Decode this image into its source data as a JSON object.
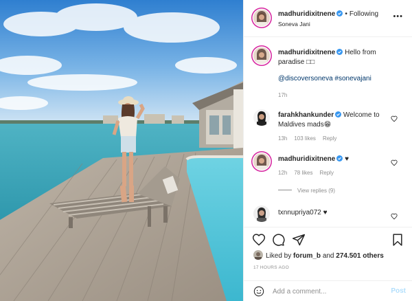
{
  "post": {
    "username": "madhuridixitnene",
    "follow_status": "Following",
    "location": "Soneva Jani",
    "caption": "Hello from paradise",
    "caption_tags": "@discoversoneva #sonevajani",
    "caption_time": "17h"
  },
  "comments": [
    {
      "username": "farahkhankunder",
      "text": "Welcome to Maldives mads😁",
      "time": "13h",
      "likes": "103 likes",
      "reply": "Reply"
    },
    {
      "username": "madhuridixitnene",
      "text": "♥",
      "time": "12h",
      "likes": "78 likes",
      "reply": "Reply",
      "view_replies": "View replies (9)"
    },
    {
      "username": "txnnupriya072",
      "text": "♥"
    }
  ],
  "engagement": {
    "liked_by_prefix": "Liked by",
    "liked_by_user": "forum_b",
    "and": "and",
    "others_count": "274.501 others",
    "time_ago": "17 HOURS AGO"
  },
  "composer": {
    "placeholder": "Add a comment...",
    "post_label": "Post"
  },
  "icons": [
    "more-icon",
    "heart-icon",
    "comment-icon",
    "share-icon",
    "bookmark-icon",
    "smiley-icon",
    "verified-icon"
  ],
  "colors": {
    "link": "#00376b",
    "muted": "#8e8e8e",
    "verified": "#3897f0",
    "post_disabled": "#b2dffc",
    "story_ring": "#d6249f"
  }
}
